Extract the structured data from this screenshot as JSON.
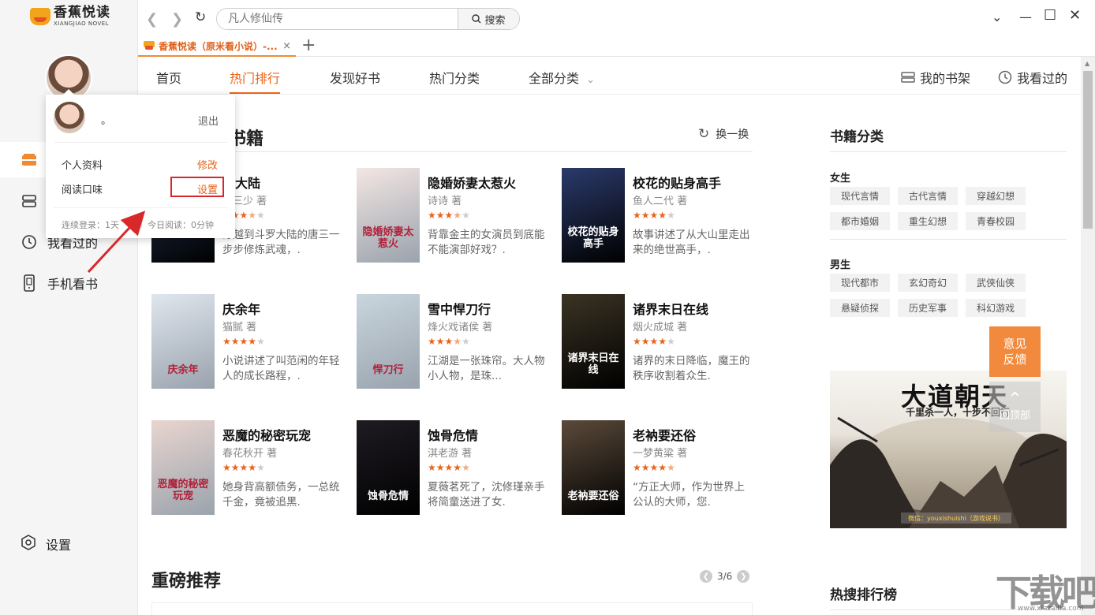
{
  "app": {
    "logo_cn": "香蕉悦读",
    "logo_en": "XIANGJIAO NOVEL"
  },
  "sidebar": {
    "items": [
      {
        "label": "",
        "icon": "bookstore-icon"
      },
      {
        "label": "",
        "icon": "bookshelf-icon"
      },
      {
        "label": "我看过的",
        "icon": "clock-icon"
      },
      {
        "label": "手机看书",
        "icon": "phone-icon"
      }
    ],
    "settings_label": "设置"
  },
  "browser": {
    "search_placeholder": "凡人修仙传",
    "search_button": "搜索",
    "tab_title": "香蕉悦读（原米看小说）-...",
    "tab_close": "×",
    "tab_add": "+"
  },
  "mainnav": {
    "items": [
      "首页",
      "热门排行",
      "发现好书",
      "热门分类",
      "全部分类"
    ],
    "active_index": 1,
    "my_shelf": "我的书架",
    "history": "我看过的"
  },
  "hot_section": {
    "title_visible": "书籍",
    "refresh_label": "换一换",
    "books": [
      {
        "title": "罗大陆",
        "author": "家三少 著",
        "rating": 3.5,
        "desc": "穿越到斗罗大陆的唐三一步步修炼武魂，.",
        "cover_text": "",
        "cover_color": "#2a3a5a"
      },
      {
        "title": "隐婚娇妻太惹火",
        "author": "诗诗 著",
        "rating": 3.5,
        "desc": "背靠金主的女演员到底能不能演部好戏？.",
        "cover_text": "隐婚娇妻太惹火",
        "cover_color": "#f3e6e3"
      },
      {
        "title": "校花的贴身高手",
        "author": "鱼人二代 著",
        "rating": 4,
        "desc": "故事讲述了从大山里走出来的绝世高手，.",
        "cover_text": "校花的贴身高手",
        "cover_color": "#2b3a6b"
      },
      {
        "title": "庆余年",
        "author": "猫腻 著",
        "rating": 4,
        "desc": "小说讲述了叫范闲的年轻人的成长路程，.",
        "cover_text": "庆余年",
        "cover_color": "#dfe6ee"
      },
      {
        "title": "雪中悍刀行",
        "author": "烽火戏诸侯 著",
        "rating": 3.5,
        "desc": "江湖是一张珠帘。大人物小人物，是珠...",
        "cover_text": "悍刀行",
        "cover_color": "#c9d6de"
      },
      {
        "title": "诸界末日在线",
        "author": "烟火成城 著",
        "rating": 4,
        "desc": "诸界的末日降临，魔王的秩序收割着众生.",
        "cover_text": "诸界末日在线",
        "cover_color": "#3b3424"
      },
      {
        "title": "恶魔的秘密玩宠",
        "author": "春花秋开 著",
        "rating": 4,
        "desc": "她身背高额债务，一总统千金，竟被追黑.",
        "cover_text": "恶魔的秘密玩宠",
        "cover_color": "#e9d5cf"
      },
      {
        "title": "蚀骨危情",
        "author": "淇老游 著",
        "rating": 4.5,
        "desc": "夏薇茗死了，沈修瑾亲手将简童送进了女.",
        "cover_text": "蚀骨危情",
        "cover_color": "#1f1b22"
      },
      {
        "title": "老衲要还俗",
        "author": "一梦黄粱 著",
        "rating": 4.5,
        "desc": "“方正大师，作为世界上公认的大师，您.",
        "cover_text": "老衲要还俗",
        "cover_color": "#5b4a3a"
      }
    ]
  },
  "recommend_section": {
    "title": "重磅推荐",
    "pager": "3/6"
  },
  "right_panel": {
    "category_title": "书籍分类",
    "female_label": "女生",
    "female_tags": [
      "现代言情",
      "古代言情",
      "穿越幻想",
      "都市婚姻",
      "重生幻想",
      "青春校园"
    ],
    "male_label": "男生",
    "male_tags": [
      "现代都市",
      "玄幻奇幻",
      "武侠仙侠",
      "悬疑侦探",
      "历史军事",
      "科幻游戏"
    ],
    "ad_title": "大道朝天",
    "ad_subtitle": "千里杀一人，十步不回行",
    "ad_footer": "微信：youxishuishi（游戏说书）",
    "feedback": "意见反馈",
    "to_top": "回顶部",
    "hot_search_title": "热搜排行榜"
  },
  "popup": {
    "username": "。",
    "logout": "退出",
    "profile_label": "个人资料",
    "profile_action": "修改",
    "taste_label": "阅读口味",
    "taste_action": "设置",
    "login_streak": "连续登录：1天",
    "today_read": "今日阅读：0分钟"
  },
  "watermark": {
    "text": "下载吧",
    "url": "www.xiazaiba.com"
  },
  "colors": {
    "accent": "#e8641b",
    "highlight_box": "#d8282a",
    "feedback_bg": "#f28a3d"
  }
}
